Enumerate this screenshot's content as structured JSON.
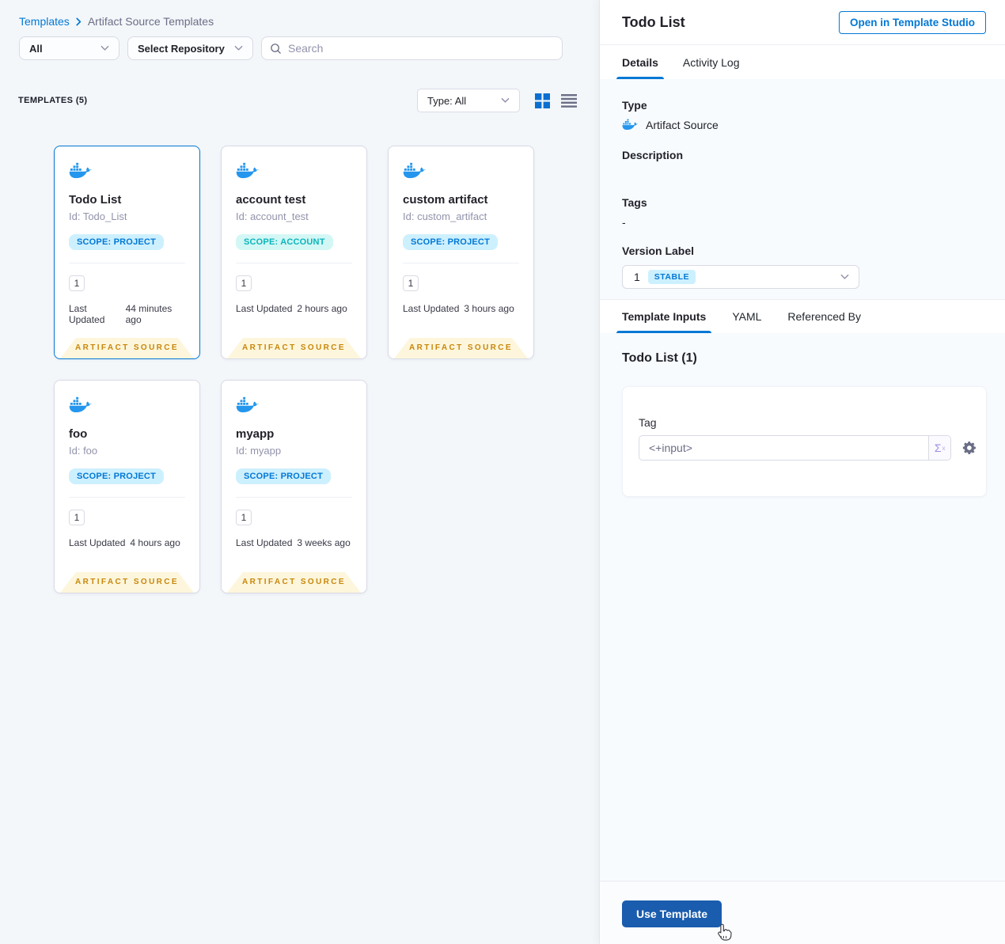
{
  "breadcrumb": {
    "root": "Templates",
    "current": "Artifact Source Templates"
  },
  "filters": {
    "scope_dropdown": "All",
    "repository_dropdown": "Select Repository",
    "search_placeholder": "Search"
  },
  "toolbar": {
    "count_label": "TEMPLATES (5)",
    "type_filter": "Type: All"
  },
  "card_common": {
    "last_updated_label": "Last Updated",
    "footer": "ARTIFACT SOURCE"
  },
  "cards": [
    {
      "title": "Todo List",
      "id": "Id: Todo_List",
      "scope": "SCOPE: PROJECT",
      "scope_type": "project",
      "version": "1",
      "last_updated": "44 minutes ago",
      "selected": true
    },
    {
      "title": "account test",
      "id": "Id: account_test",
      "scope": "SCOPE: ACCOUNT",
      "scope_type": "account",
      "version": "1",
      "last_updated": "2 hours ago",
      "selected": false
    },
    {
      "title": "custom artifact",
      "id": "Id: custom_artifact",
      "scope": "SCOPE: PROJECT",
      "scope_type": "project",
      "version": "1",
      "last_updated": "3 hours ago",
      "selected": false
    },
    {
      "title": "foo",
      "id": "Id: foo",
      "scope": "SCOPE: PROJECT",
      "scope_type": "project",
      "version": "1",
      "last_updated": "4 hours ago",
      "selected": false
    },
    {
      "title": "myapp",
      "id": "Id: myapp",
      "scope": "SCOPE: PROJECT",
      "scope_type": "project",
      "version": "1",
      "last_updated": "3 weeks ago",
      "selected": false
    }
  ],
  "panel": {
    "title": "Todo List",
    "open_button": "Open in Template Studio",
    "tabs": {
      "details": "Details",
      "activity_log": "Activity Log"
    },
    "details": {
      "type_label": "Type",
      "type_value": "Artifact Source",
      "description_label": "Description",
      "tags_label": "Tags",
      "tags_value": "-",
      "version_label": "Version Label",
      "version_value": "1",
      "version_badge": "STABLE"
    },
    "inner_tabs": {
      "template_inputs": "Template Inputs",
      "yaml": "YAML",
      "referenced_by": "Referenced By"
    },
    "inputs": {
      "heading": "Todo List (1)",
      "tag_label": "Tag",
      "tag_value": "<+input>",
      "sigma": "Σ",
      "sigma_sup": "x"
    },
    "use_template_button": "Use Template"
  },
  "colors": {
    "primary_blue": "#0278d5",
    "docker_blue": "#2496ed",
    "use_template_button": "#1a5cad",
    "ribbon_bg": "#fdf6dc",
    "ribbon_text": "#c8870b",
    "scope_project_bg": "#cdf0fe",
    "scope_project_text": "#0278d5",
    "scope_account_bg": "#d3f7f5",
    "scope_account_text": "#0ab5bb",
    "stable_badge_bg": "#cdf0fe",
    "stable_badge_text": "#0278d5"
  }
}
